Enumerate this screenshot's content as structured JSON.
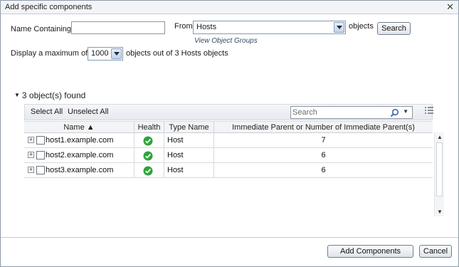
{
  "dialog": {
    "title": "Add specific components",
    "close_glyph": "✕"
  },
  "filters": {
    "name_label": "Name Containing",
    "name_value": "",
    "from_label": "From",
    "from_value": "Hosts",
    "objects_label": "objects",
    "search_button": "Search",
    "view_groups_link": "View Object Groups",
    "display_label": "Display a maximum of",
    "max_value": "1000",
    "summary": "objects out of 3 Hosts objects"
  },
  "results": {
    "found_label": "3 object(s) found",
    "toolbar": {
      "select_all": "Select All",
      "unselect_all": "Unselect All",
      "search_placeholder": "Search"
    },
    "columns": [
      "Name ▲",
      "Health",
      "Type Name",
      "Immediate Parent or Number of Immediate Parent(s)"
    ],
    "rows": [
      {
        "name": "host1.example.com",
        "type": "Host",
        "parents": "7"
      },
      {
        "name": "host2.example.com",
        "type": "Host",
        "parents": "6"
      },
      {
        "name": "host3.example.com",
        "type": "Host",
        "parents": "6"
      }
    ]
  },
  "footer": {
    "add_button": "Add Components",
    "cancel_button": "Cancel"
  },
  "colors": {
    "health_ok": "#2ea43a",
    "link": "#3a4b66"
  },
  "icons": [
    "close-icon",
    "dropdown-arrow-icon",
    "search-icon",
    "columns-icon",
    "expand-icon",
    "health-ok-icon",
    "collapse-triangle-icon"
  ]
}
